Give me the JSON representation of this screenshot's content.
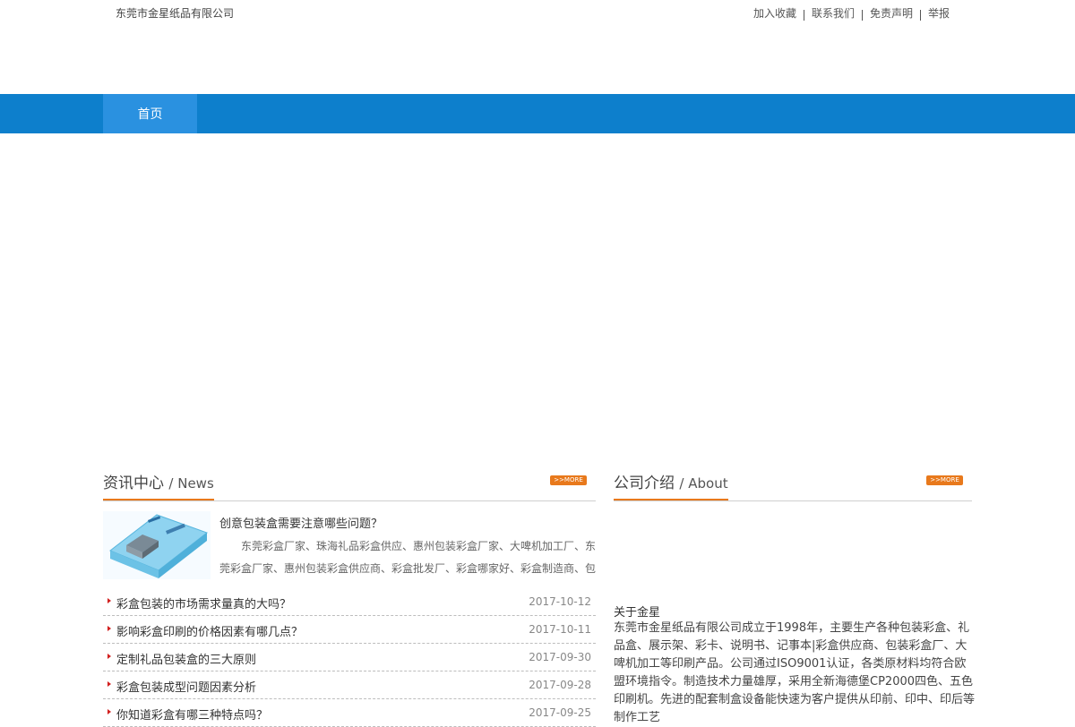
{
  "header": {
    "company_name": "东莞市金星纸品有限公司",
    "links": [
      "加入收藏",
      "联系我们",
      "免责声明",
      "举报"
    ]
  },
  "nav": {
    "items": [
      "首页"
    ],
    "active_color": "#2a91e0",
    "bar_color": "#0d7fcc"
  },
  "news": {
    "title_cn": "资讯中心",
    "title_en": "/ News",
    "more_label": ">>MORE",
    "featured": {
      "title": "创意包装盒需要注意哪些问题？",
      "summary": "东莞彩盒厂家、珠海礼品彩盒供应、惠州包装彩盒厂家、大啤机加工厂、东莞彩盒厂家、惠州包装彩盒供应商、彩盒批发厂、彩盒哪家好、彩盒制造商、包"
    },
    "items": [
      {
        "title": "彩盒包装的市场需求量真的大吗？",
        "date": "2017-10-12"
      },
      {
        "title": "影响彩盒印刷的价格因素有哪几点？",
        "date": "2017-10-11"
      },
      {
        "title": "定制礼品包装盒的三大原则",
        "date": "2017-09-30"
      },
      {
        "title": "彩盒包装成型问题因素分析",
        "date": "2017-09-28"
      },
      {
        "title": "你知道彩盒有哪三种特点吗？",
        "date": "2017-09-25"
      }
    ]
  },
  "about": {
    "title_cn": "公司介绍",
    "title_en": "/ About",
    "more_label": ">>MORE",
    "heading": "关于金星",
    "text": "东莞市金星纸品有限公司成立于1998年，主要生产各种包装彩盒、礼品盒、展示架、彩卡、说明书、记事本|彩盒供应商、包装彩盒厂、大啤机加工等印刷产品。公司通过ISO9001认证，各类原材料均符合欧盟环境指令。制造技术力量雄厚，采用全新海德堡CP2000四色、五色印刷机。先进的配套制盒设备能快速为客户提供从印前、印中、印后等制作工艺"
  },
  "colors": {
    "accent_orange": "#e8791c",
    "bullet_red": "#d2201f"
  }
}
